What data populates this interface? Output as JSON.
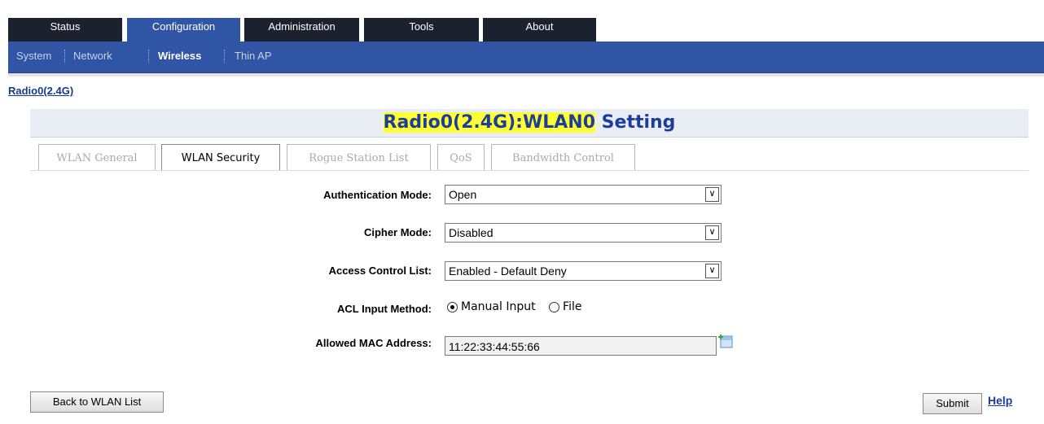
{
  "top_tabs": [
    "Status",
    "Configuration",
    "Administration",
    "Tools",
    "About"
  ],
  "nav_links": [
    "System",
    "Network",
    "Wireless",
    "Thin AP"
  ],
  "breadcrumb": "Radio0(2.4G)",
  "page_title": {
    "highlight": "Radio0(2.4G):WLAN0",
    "rest": " Setting"
  },
  "sub_tabs": [
    "WLAN General",
    "WLAN Security",
    "Rogue Station List",
    "QoS",
    "Bandwidth Control"
  ],
  "form": {
    "auth_mode": {
      "label": "Authentication Mode:",
      "value": "Open"
    },
    "cipher_mode": {
      "label": "Cipher Mode:",
      "value": "Disabled"
    },
    "acl": {
      "label": "Access Control List:",
      "value": "Enabled - Default Deny"
    },
    "acl_input": {
      "label": "ACL Input Method:",
      "option_manual": "Manual Input",
      "option_file": "File",
      "selected": "Manual Input"
    },
    "mac": {
      "label": "Allowed MAC Address:",
      "value": "11:22:33:44:55:66"
    }
  },
  "buttons": {
    "back": "Back to WLAN List",
    "submit": "Submit",
    "help": "Help"
  },
  "colors": {
    "nav_blue": "#2f55a4",
    "tab_dark": "#1c2130",
    "title_highlight": "#ffff33",
    "title_text": "#1d3d9a"
  }
}
